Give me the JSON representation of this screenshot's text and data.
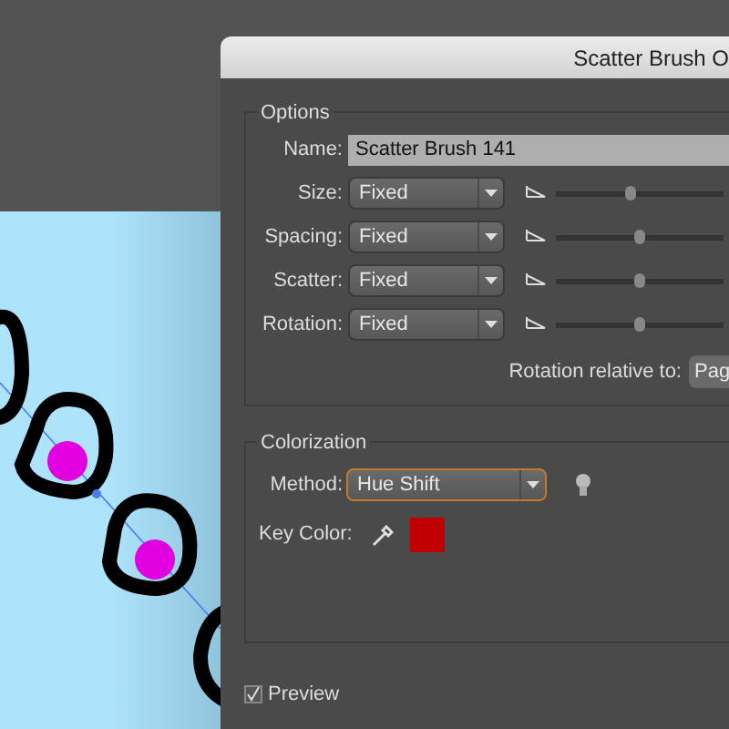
{
  "dialog": {
    "title": "Scatter Brush O"
  },
  "options": {
    "legend": "Options",
    "name_label": "Name:",
    "name_value": "Scatter Brush 141",
    "rows": [
      {
        "label": "Size:",
        "value": "Fixed",
        "level": 0.45
      },
      {
        "label": "Spacing:",
        "value": "Fixed",
        "level": 0.5
      },
      {
        "label": "Scatter:",
        "value": "Fixed",
        "level": 0.5
      },
      {
        "label": "Rotation:",
        "value": "Fixed",
        "level": 0.5
      }
    ],
    "rotation_label": "Rotation relative to:",
    "rotation_value": "Pag"
  },
  "colorization": {
    "legend": "Colorization",
    "method_label": "Method:",
    "method_value": "Hue Shift",
    "method_focused": true,
    "key_color_label": "Key Color:",
    "key_color_swatch": {
      "color": "#c00000"
    }
  },
  "preview": {
    "label": "Preview",
    "checked": true
  }
}
